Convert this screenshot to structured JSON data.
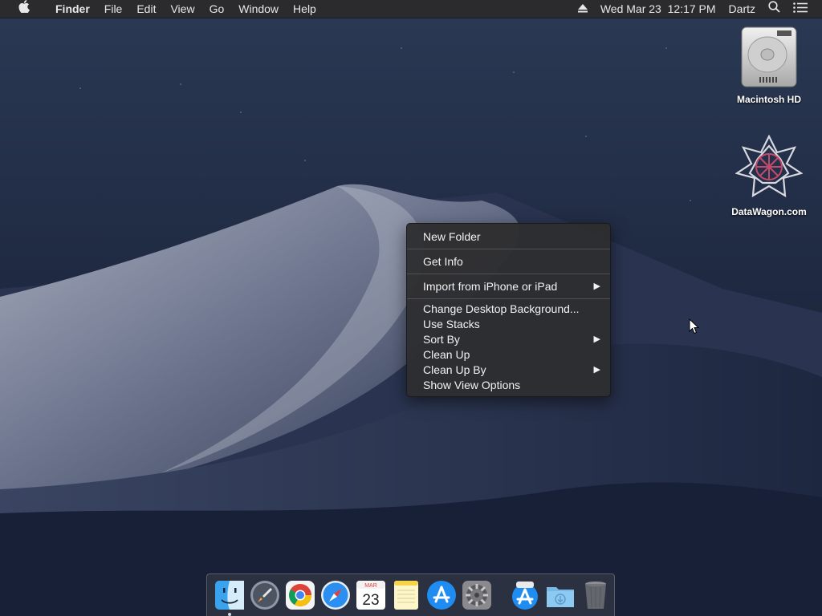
{
  "menubar": {
    "apple_icon": "apple-icon",
    "app_name": "Finder",
    "menus": [
      "File",
      "Edit",
      "View",
      "Go",
      "Window",
      "Help"
    ],
    "clock": "Wed Mar 23  12:17 PM",
    "user": "Dartz",
    "status_icons": [
      "eject-icon",
      "search-icon",
      "notification-center-icon"
    ]
  },
  "desktop_icons": [
    {
      "label": "Macintosh HD",
      "icon": "hard-drive-icon"
    },
    {
      "label": "DataWagon.com",
      "icon": "datawagon-icon"
    }
  ],
  "context_menu": {
    "groups": [
      [
        {
          "label": "New Folder"
        }
      ],
      [
        {
          "label": "Get Info"
        }
      ],
      [
        {
          "label": "Import from iPhone or iPad",
          "submenu": true
        }
      ],
      [
        {
          "label": "Change Desktop Background..."
        },
        {
          "label": "Use Stacks"
        },
        {
          "label": "Sort By",
          "submenu": true
        },
        {
          "label": "Clean Up"
        },
        {
          "label": "Clean Up By",
          "submenu": true
        },
        {
          "label": "Show View Options"
        }
      ]
    ]
  },
  "dock": {
    "apps": [
      {
        "name": "finder-icon",
        "running": true
      },
      {
        "name": "launchpad-icon",
        "running": false
      },
      {
        "name": "chrome-icon",
        "running": false
      },
      {
        "name": "safari-icon",
        "running": false
      },
      {
        "name": "calendar-icon",
        "running": false,
        "month": "MAR",
        "day": "23"
      },
      {
        "name": "notes-icon",
        "running": false
      },
      {
        "name": "app-store-icon",
        "running": false
      },
      {
        "name": "system-preferences-icon",
        "running": false
      }
    ],
    "others": [
      {
        "name": "app-store-downloads-icon"
      },
      {
        "name": "downloads-folder-icon"
      },
      {
        "name": "trash-icon"
      }
    ]
  },
  "colors": {
    "menubar_bg": "#2b2b2d",
    "menu_bg": "#2e2e30",
    "wallpaper_sky": "#1e2a44",
    "wallpaper_dune": "#8e95a8"
  }
}
